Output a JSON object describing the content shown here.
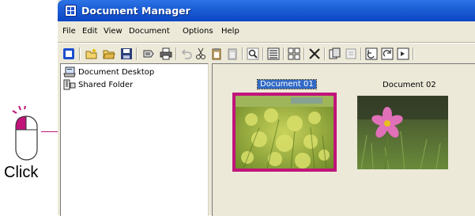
{
  "window": {
    "title": "Document Manager"
  },
  "menu": [
    "File",
    "Edit",
    "View",
    "Document",
    "Options",
    "Help"
  ],
  "toolbar": {
    "buttons": [
      "app-icon",
      "new-folder-icon",
      "open-folder-icon",
      "save-icon",
      "send-icon",
      "print-icon",
      "undo-icon",
      "cut-icon",
      "copy-icon",
      "paste-icon",
      "search-icon",
      "list-view-icon",
      "thumbnail-view-icon",
      "delete-icon",
      "duplicate-icon",
      "properties-icon",
      "rotate-left-icon",
      "rotate-right-icon",
      "export-icon"
    ]
  },
  "tree": {
    "items": [
      {
        "label": "Document Desktop",
        "icon": "desktop-icon"
      },
      {
        "label": "Shared Folder",
        "icon": "shared-folder-icon"
      }
    ]
  },
  "documents": [
    {
      "label": "Document 01",
      "selected": true,
      "image": "yellow-flowers"
    },
    {
      "label": "Document 02",
      "selected": false,
      "image": "pink-cosmos-flower"
    }
  ],
  "annotation": {
    "text": "Click"
  },
  "colors": {
    "title_bar": "#0a46c4",
    "selection_border": "#c0147a",
    "selected_label": "#316ac5"
  }
}
